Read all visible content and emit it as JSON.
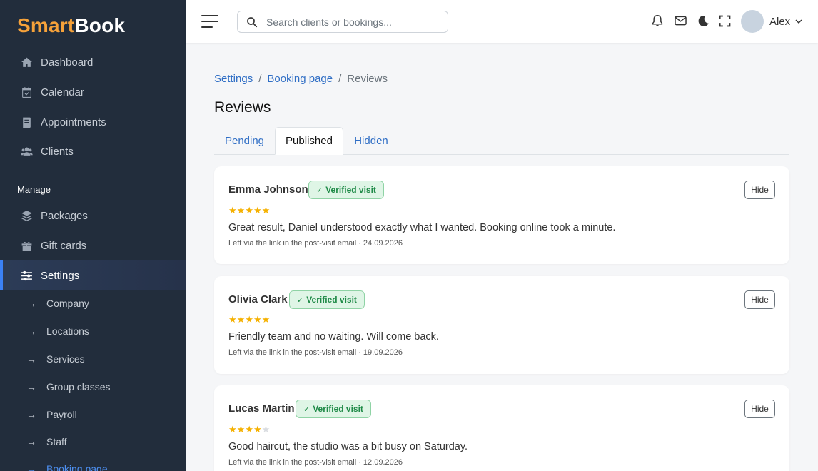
{
  "brand": {
    "part1": "Smart",
    "part2": "Book"
  },
  "sidebar": {
    "main_items": [
      {
        "label": "Dashboard",
        "icon": "home-icon"
      },
      {
        "label": "Calendar",
        "icon": "calendar-check-icon"
      },
      {
        "label": "Appointments",
        "icon": "book-icon"
      },
      {
        "label": "Clients",
        "icon": "users-icon"
      }
    ],
    "section_label": "Manage",
    "manage_items": [
      {
        "label": "Packages",
        "icon": "layers-icon"
      },
      {
        "label": "Gift cards",
        "icon": "gift-icon"
      },
      {
        "label": "Settings",
        "icon": "sliders-icon",
        "active": true
      }
    ],
    "settings_sub": [
      {
        "label": "Company"
      },
      {
        "label": "Locations"
      },
      {
        "label": "Services"
      },
      {
        "label": "Group classes"
      },
      {
        "label": "Payroll"
      },
      {
        "label": "Staff"
      },
      {
        "label": "Booking page",
        "current": true
      }
    ],
    "arrow_glyph": "→"
  },
  "header": {
    "search_placeholder": "Search clients or bookings...",
    "user_name": "Alex",
    "icons": [
      "bell-icon",
      "mail-icon",
      "moon-icon",
      "fullscreen-icon"
    ]
  },
  "breadcrumb": {
    "items": [
      "Settings",
      "Booking page"
    ],
    "current": "Reviews",
    "sep": "/"
  },
  "page_title": "Reviews",
  "tabs": [
    {
      "label": "Pending"
    },
    {
      "label": "Published",
      "active": true
    },
    {
      "label": "Hidden"
    }
  ],
  "reviews": [
    {
      "name": "Emma Johnson",
      "badge": "Verified visit",
      "rating": 5,
      "text": "Great result, Daniel understood exactly what I wanted. Booking online took a minute.",
      "meta": "Left via the link in the post-visit email · 24.09.2026",
      "action": "Hide"
    },
    {
      "name": "Olivia Clark",
      "badge": "Verified visit",
      "rating": 5,
      "text": "Friendly team and no waiting. Will come back.",
      "meta": "Left via the link in the post-visit email · 19.09.2026",
      "action": "Hide"
    },
    {
      "name": "Lucas Martin",
      "badge": "Verified visit",
      "rating": 4,
      "text": "Good haircut, the studio was a bit busy on Saturday.",
      "meta": "Left via the link in the post-visit email · 12.09.2026",
      "action": "Hide"
    }
  ],
  "colors": {
    "sidebar_bg": "#222d3c",
    "accent": "#3b82f6",
    "brand_orange": "#f6a23a",
    "badge_green": "#1f8a47",
    "star": "#f5b100"
  }
}
